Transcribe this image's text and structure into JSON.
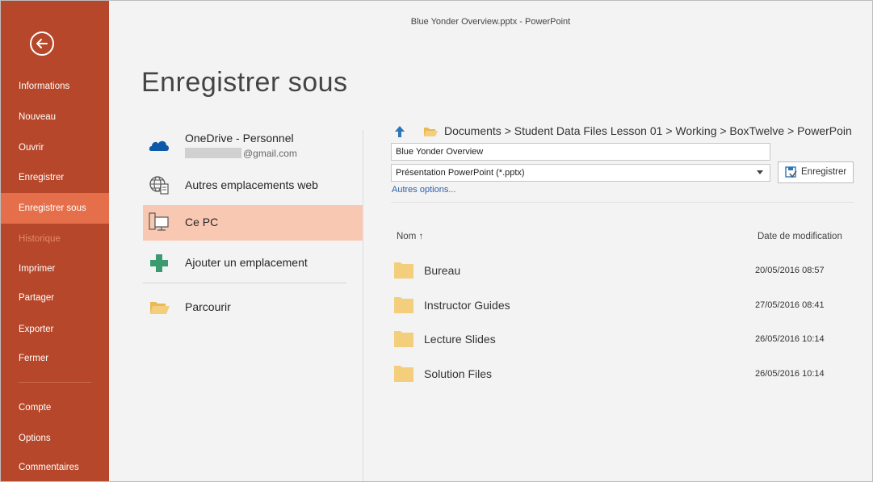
{
  "window": {
    "title": "Blue Yonder Overview.pptx - PowerPoint"
  },
  "colors": {
    "sidebar": "#b7472a",
    "sidebar_active": "#e66f4b",
    "selected_location": "#f9c8b2",
    "folder": "#f3cf7d",
    "accent_blue": "#2e75b6"
  },
  "sidebar": {
    "back_icon": "back-arrow-icon",
    "items": [
      {
        "label": "Informations",
        "state": "normal"
      },
      {
        "label": "Nouveau",
        "state": "normal"
      },
      {
        "label": "Ouvrir",
        "state": "normal"
      },
      {
        "label": "Enregistrer",
        "state": "normal"
      },
      {
        "label": "Enregistrer sous",
        "state": "active"
      },
      {
        "label": "Historique",
        "state": "disabled"
      },
      {
        "label": "Imprimer",
        "state": "normal"
      },
      {
        "label": "Partager",
        "state": "normal"
      },
      {
        "label": "Exporter",
        "state": "normal"
      },
      {
        "label": "Fermer",
        "state": "normal"
      },
      {
        "label": "Compte",
        "state": "normal"
      },
      {
        "label": "Options",
        "state": "normal"
      },
      {
        "label": "Commentaires",
        "state": "normal"
      }
    ]
  },
  "page": {
    "title": "Enregistrer sous"
  },
  "locations": [
    {
      "label": "OneDrive - Personnel",
      "sublabel": "@gmail.com",
      "icon": "onedrive-cloud-icon",
      "selected": false
    },
    {
      "label": "Autres emplacements web",
      "icon": "globe-icon",
      "selected": false
    },
    {
      "label": "Ce PC",
      "icon": "computer-icon",
      "selected": true
    },
    {
      "label": "Ajouter un emplacement",
      "icon": "plus-icon",
      "selected": false
    },
    {
      "label": "Parcourir",
      "icon": "open-folder-icon",
      "selected": false
    }
  ],
  "save_pane": {
    "breadcrumb": "Documents > Student Data Files Lesson 01 > Working > BoxTwelve > PowerPoin",
    "filename": "Blue Yonder Overview",
    "file_type": "Présentation PowerPoint (*.pptx)",
    "save_button": "Enregistrer",
    "more_options": "Autres options...",
    "columns": {
      "name": "Nom ↑",
      "date": "Date de modification"
    },
    "files": [
      {
        "name": "Bureau",
        "date": "20/05/2016 08:57"
      },
      {
        "name": "Instructor Guides",
        "date": "27/05/2016 08:41"
      },
      {
        "name": "Lecture Slides",
        "date": "26/05/2016 10:14"
      },
      {
        "name": "Solution Files",
        "date": "26/05/2016 10:14"
      }
    ]
  }
}
